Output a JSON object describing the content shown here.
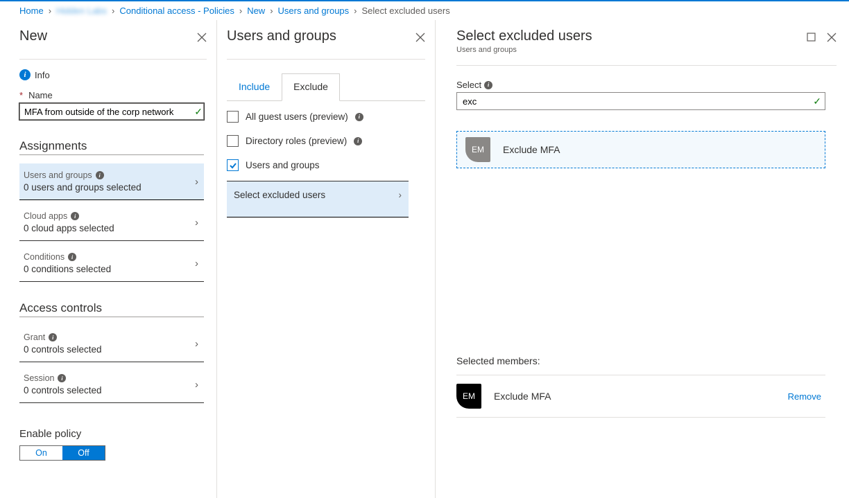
{
  "breadcrumbs": {
    "home": "Home",
    "org": "Hidden Labs",
    "conditional": "Conditional access - Policies",
    "newitem": "New",
    "users_groups": "Users and groups",
    "current": "Select excluded users"
  },
  "blade_new": {
    "title": "New",
    "info_label": "Info",
    "name_label": "Name",
    "name_value": "MFA from outside of the corp network",
    "assignments_title": "Assignments",
    "users_groups": {
      "label": "Users and groups",
      "value": "0 users and groups selected"
    },
    "cloud_apps": {
      "label": "Cloud apps",
      "value": "0 cloud apps selected"
    },
    "conditions": {
      "label": "Conditions",
      "value": "0 conditions selected"
    },
    "access_controls_title": "Access controls",
    "grant": {
      "label": "Grant",
      "value": "0 controls selected"
    },
    "session": {
      "label": "Session",
      "value": "0 controls selected"
    },
    "enable_policy_label": "Enable policy",
    "toggle_on": "On",
    "toggle_off": "Off"
  },
  "blade_ug": {
    "title": "Users and groups",
    "tab_include": "Include",
    "tab_exclude": "Exclude",
    "all_guest": "All guest users (preview)",
    "directory_roles": "Directory roles (preview)",
    "users_groups": "Users and groups",
    "select_excluded": "Select excluded users"
  },
  "blade_select": {
    "title": "Select excluded users",
    "subtitle": "Users and groups",
    "select_label": "Select",
    "search_value": "exc",
    "result_initials": "EM",
    "result_name": "Exclude MFA",
    "selected_members_label": "Selected members:",
    "selected_initials": "EM",
    "selected_name": "Exclude MFA",
    "remove_label": "Remove"
  }
}
